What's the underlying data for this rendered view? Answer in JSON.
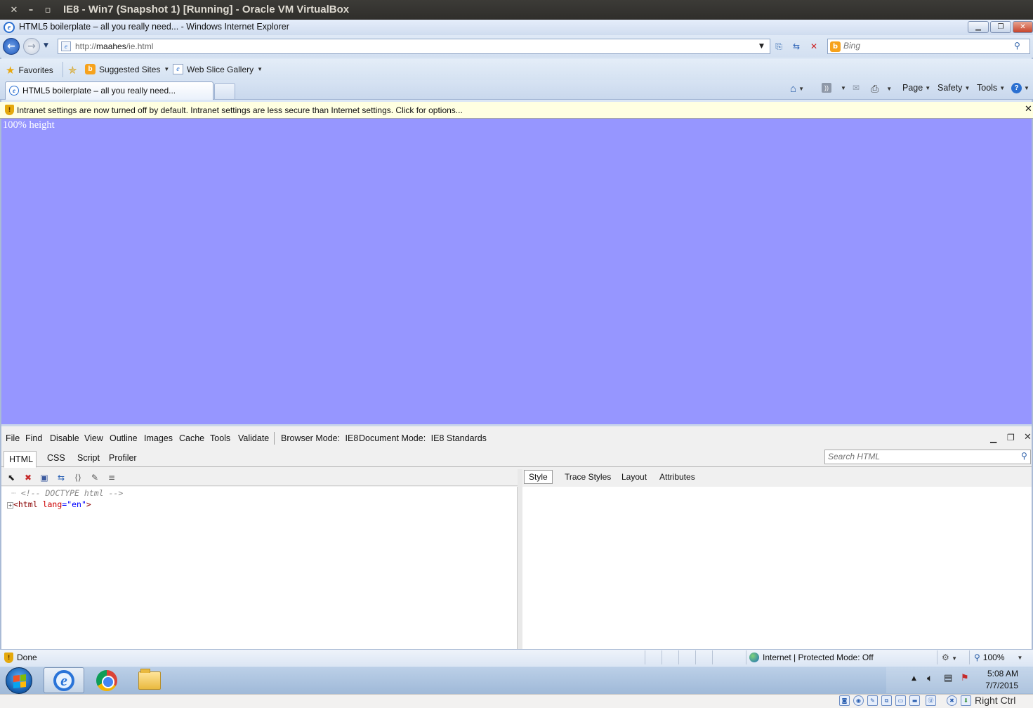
{
  "vbox": {
    "title": "IE8 - Win7 (Snapshot 1) [Running] - Oracle VM VirtualBox",
    "close": "✕",
    "minimize": "–",
    "maximize": "▫",
    "right_ctrl": "Right Ctrl"
  },
  "ie": {
    "window_title": "HTML5 boilerplate – all you really need... - Windows Internet Explorer",
    "address": {
      "prefix": "http://",
      "host": "maahes",
      "path": "/ie.html"
    },
    "search_placeholder": "Bing",
    "favorites_bar": {
      "favorites": "Favorites",
      "suggested_sites": "Suggested Sites",
      "web_slice_gallery": "Web Slice Gallery"
    },
    "tab": {
      "title": "HTML5 boilerplate – all you really need..."
    },
    "command_bar": {
      "page": "Page",
      "safety": "Safety",
      "tools": "Tools"
    },
    "info_bar": "Intranet settings are now turned off by default. Intranet settings are less secure than Internet settings. Click for options...",
    "page_content": "100% height",
    "status": {
      "done": "Done",
      "zone": "Internet | Protected Mode: Off",
      "zoom": "100%"
    }
  },
  "devtools": {
    "menu": [
      "File",
      "Find",
      "Disable",
      "View",
      "Outline",
      "Images",
      "Cache",
      "Tools",
      "Validate"
    ],
    "browser_mode_label": "Browser Mode:",
    "browser_mode_value": "IE8",
    "document_mode_label": "Document Mode:",
    "document_mode_value": "IE8 Standards",
    "tabs": [
      "HTML",
      "CSS",
      "Script",
      "Profiler"
    ],
    "search_placeholder": "Search HTML",
    "tree": {
      "comment": "<!-- DOCTYPE html -->",
      "tag_open": "<html",
      "attr_name": "lang",
      "attr_eq": "=",
      "attr_value": "\"en\"",
      "tag_close": ">"
    },
    "panel_tabs": [
      "Style",
      "Trace Styles",
      "Layout",
      "Attributes"
    ]
  },
  "taskbar": {
    "time": "5:08 AM",
    "date": "7/7/2015"
  },
  "colors": {
    "page_background": "#9696ff",
    "info_bar": "#ffffe1",
    "vbox_title_bar": "#3c3b37"
  }
}
